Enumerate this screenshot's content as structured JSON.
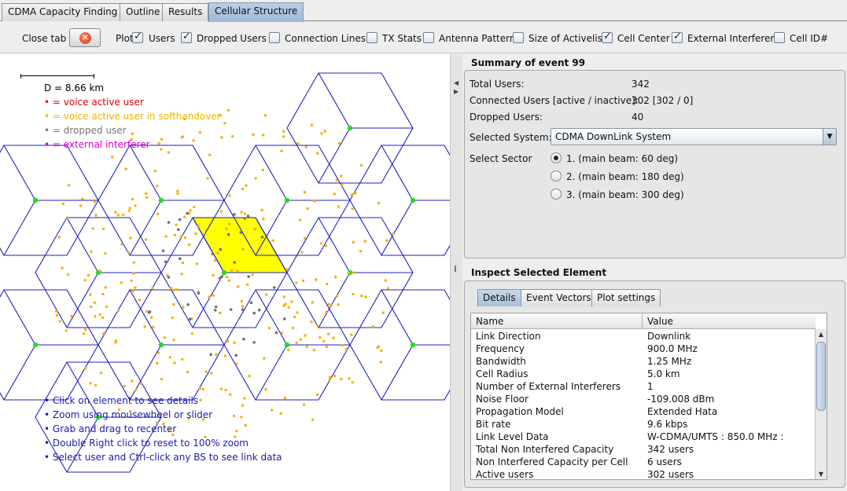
{
  "tabs": [
    {
      "label": "CDMA Capacity Finding"
    },
    {
      "label": "Outline"
    },
    {
      "label": "Results"
    },
    {
      "label": "Cellular Structure"
    }
  ],
  "toolbar": {
    "close_tab": "Close tab",
    "plot_label": "Plot:",
    "options": [
      {
        "label": "Users",
        "checked": true
      },
      {
        "label": "Dropped Users",
        "checked": true
      },
      {
        "label": "Connection Lines",
        "checked": false
      },
      {
        "label": "TX Stats",
        "checked": false
      },
      {
        "label": "Antenna Pattern",
        "checked": false
      },
      {
        "label": "Size of Activelist",
        "checked": false
      },
      {
        "label": "Cell Center",
        "checked": true
      },
      {
        "label": "External Interferers",
        "checked": true
      },
      {
        "label": "Cell ID#",
        "checked": false
      }
    ]
  },
  "plot": {
    "scale_label": "D = 8.66 km",
    "legend": [
      {
        "text": "• = voice active user",
        "color": "#e00000"
      },
      {
        "text": "• = voice active user in softhandover",
        "color": "#f0b400"
      },
      {
        "text": "• = dropped user",
        "color": "#777777"
      },
      {
        "text": "• = external interferer",
        "color": "#d400d4"
      }
    ],
    "help": [
      "• Click on element to see details",
      "• Zoom using mousewheel or slider",
      "• Grab and drag to recenter",
      "• Double Right click to reset to 100% zoom",
      "• Select user and Ctrl-click any BS to see link data"
    ],
    "colors": {
      "grid": "#1f1fbf",
      "center": "#22dd22",
      "user": "#f5b000",
      "dropped": "#707070",
      "selected": "#ffff00"
    }
  },
  "summary": {
    "title": "Summary of event 99",
    "total_users_label": "Total Users:",
    "total_users": "342",
    "connected_label": "Connected Users [active / inactive]:",
    "connected": "302 [302 / 0]",
    "dropped_label": "Dropped Users:",
    "dropped": "40",
    "system_label": "Selected System:",
    "system_value": "CDMA DownLink System",
    "sector_label": "Select Sector",
    "sectors": [
      {
        "label": "1. (main beam: 60 deg)",
        "selected": true
      },
      {
        "label": "2. (main beam: 180 deg)",
        "selected": false
      },
      {
        "label": "3. (main beam: 300 deg)",
        "selected": false
      }
    ]
  },
  "inspect": {
    "title": "Inspect Selected Element",
    "tabs": [
      "Details",
      "Event Vectors",
      "Plot settings"
    ],
    "columns": [
      "Name",
      "Value"
    ],
    "rows": [
      [
        "Link Direction",
        "Downlink"
      ],
      [
        "Frequency",
        "900.0 MHz"
      ],
      [
        "Bandwidth",
        "1.25 MHz"
      ],
      [
        "Cell Radius",
        "5.0 km"
      ],
      [
        "Number of External Interferers",
        "1"
      ],
      [
        "Noise Floor",
        "-109.008 dBm"
      ],
      [
        "Propagation Model",
        "Extended Hata"
      ],
      [
        "Bit rate",
        "9.6 kbps"
      ],
      [
        "Link Level Data",
        "W-CDMA/UMTS : 850.0 MHz :"
      ],
      [
        "Total Non Interfered Capacity",
        "342 users"
      ],
      [
        "Non Interfered Capacity per Cell",
        "6 users"
      ],
      [
        "Active users",
        "302 users"
      ]
    ]
  }
}
